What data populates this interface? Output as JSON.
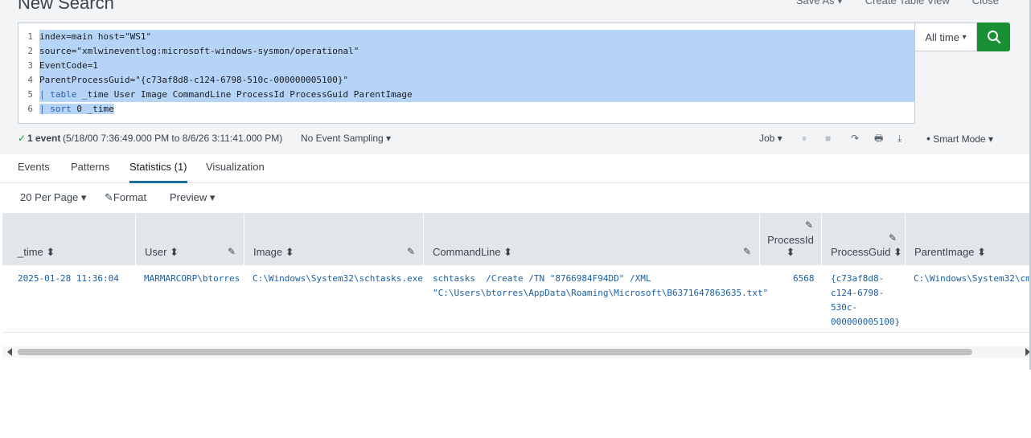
{
  "header": {
    "title": "New Search",
    "actions": [
      "Save As ▾",
      "Create Table View",
      "Close"
    ]
  },
  "search": {
    "lines": [
      {
        "n": "1",
        "text": "index=main host=\"WS1\""
      },
      {
        "n": "2",
        "text": "source=\"xmlwineventlog:microsoft-windows-sysmon/operational\""
      },
      {
        "n": "3",
        "text": "EventCode=1"
      },
      {
        "n": "4",
        "text": "ParentProcessGuid=\"{c73af8d8-c124-6798-510c-000000005100}\""
      },
      {
        "n": "5",
        "pipe": "| ",
        "kw": "table",
        "rest": " _time User Image CommandLine ProcessId ProcessGuid ParentImage"
      },
      {
        "n": "6",
        "pipe": "| ",
        "kw": "sort",
        "rest": " 0 _time"
      }
    ],
    "time_range": "All time",
    "time_range_caret": "▾"
  },
  "status": {
    "check": "✓",
    "event_count": "1 event",
    "range": "(5/18/00 7:36:49.000 PM to 8/6/26 3:11:41.000 PM)",
    "sampling": "No Event Sampling ▾",
    "job": "Job ▾",
    "pause": "⏸",
    "stop": "■",
    "share": "↷",
    "print": "🖶",
    "export": "⤓",
    "mode": "Smart Mode ▾",
    "mode_icon": "•"
  },
  "tabs": [
    {
      "label": "Events"
    },
    {
      "label": "Patterns"
    },
    {
      "label": "Statistics (1)"
    },
    {
      "label": "Visualization"
    }
  ],
  "toolbar": {
    "per_page": "20 Per Page ▾",
    "format": "Format",
    "format_icon": "✎",
    "preview": "Preview ▾"
  },
  "table": {
    "sort_glyph": "⬍",
    "edit_glyph": "✎",
    "columns": [
      "_time",
      "User",
      "Image",
      "CommandLine",
      "ProcessId",
      "ProcessGuid",
      "ParentImage"
    ],
    "row": {
      "time": "2025-01-28 11:36:04",
      "user": "MARMARCORP\\btorres",
      "image": "C:\\Windows\\System32\\schtasks.exe",
      "commandline_1": "schtasks  /Create /TN \"8766984F94DD\" /XML",
      "commandline_2": "\"C:\\Users\\btorres\\AppData\\Roaming\\Microsoft\\B6371647863635.txt\"",
      "process_id": "6568",
      "guid_1": "{c73af8d8-",
      "guid_2": "c124-6798-",
      "guid_3": "530c-",
      "guid_4": "000000005100}",
      "parent_image": "C:\\Windows\\System32\\cm"
    }
  },
  "colors": {
    "accent": "#1a9035",
    "selection": "#b6d4f7",
    "link": "#1a5fa0"
  }
}
